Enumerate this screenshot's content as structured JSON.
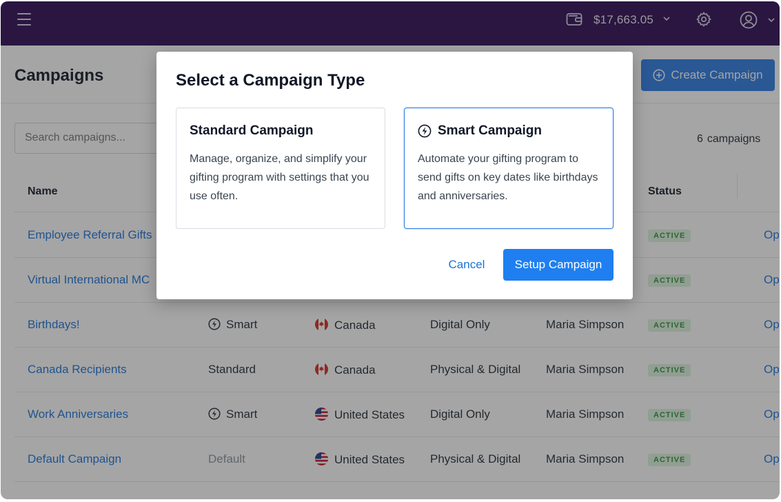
{
  "topbar": {
    "menu_icon": "hamburger-icon",
    "wallet_icon": "wallet-icon",
    "balance": "$17,663.05",
    "settings_icon": "gear-icon",
    "account_icon": "user-circle-icon",
    "bg_color": "#2c0a53"
  },
  "page": {
    "title": "Campaigns",
    "create_button": "Create Campaign",
    "search_placeholder": "Search campaigns...",
    "campaign_count": "6",
    "campaign_count_label": "campaigns"
  },
  "table": {
    "headers": {
      "name": "Name",
      "status": "Status"
    },
    "rows": [
      {
        "name": "Employee Referral Gifts",
        "type": "",
        "country": "",
        "delivery": "",
        "owner": "",
        "status": "ACTIVE",
        "action": "Op"
      },
      {
        "name": "Virtual International MC",
        "type": "",
        "country": "",
        "delivery": "",
        "owner": "",
        "status": "ACTIVE",
        "action": "Op"
      },
      {
        "name": "Birthdays!",
        "type": "Smart",
        "country": "Canada",
        "delivery": "Digital Only",
        "owner": "Maria Simpson",
        "status": "ACTIVE",
        "action": "Op"
      },
      {
        "name": "Canada Recipients",
        "type": "Standard",
        "country": "Canada",
        "delivery": "Physical & Digital",
        "owner": "Maria Simpson",
        "status": "ACTIVE",
        "action": "Op"
      },
      {
        "name": "Work Anniversaries",
        "type": "Smart",
        "country": "United States",
        "delivery": "Digital Only",
        "owner": "Maria Simpson",
        "status": "ACTIVE",
        "action": "Op"
      },
      {
        "name": "Default Campaign",
        "type": "Default",
        "country": "United States",
        "delivery": "Physical & Digital",
        "owner": "Maria Simpson",
        "status": "ACTIVE",
        "action": "Op"
      }
    ]
  },
  "modal": {
    "title": "Select a Campaign Type",
    "standard": {
      "title": "Standard Campaign",
      "description": "Manage, organize, and simplify your gifting program with settings that you use often."
    },
    "smart": {
      "title": "Smart Campaign",
      "description": "Automate your gifting program to send gifts on key dates like birthdays and anniversaries.",
      "icon": "lightning-bolt-icon"
    },
    "cancel": "Cancel",
    "setup": "Setup Campaign"
  },
  "colors": {
    "accent": "#2a7be4",
    "link": "#1a73d9",
    "active_badge_bg": "#dcf3df",
    "active_badge_text": "#2f8f3a"
  }
}
